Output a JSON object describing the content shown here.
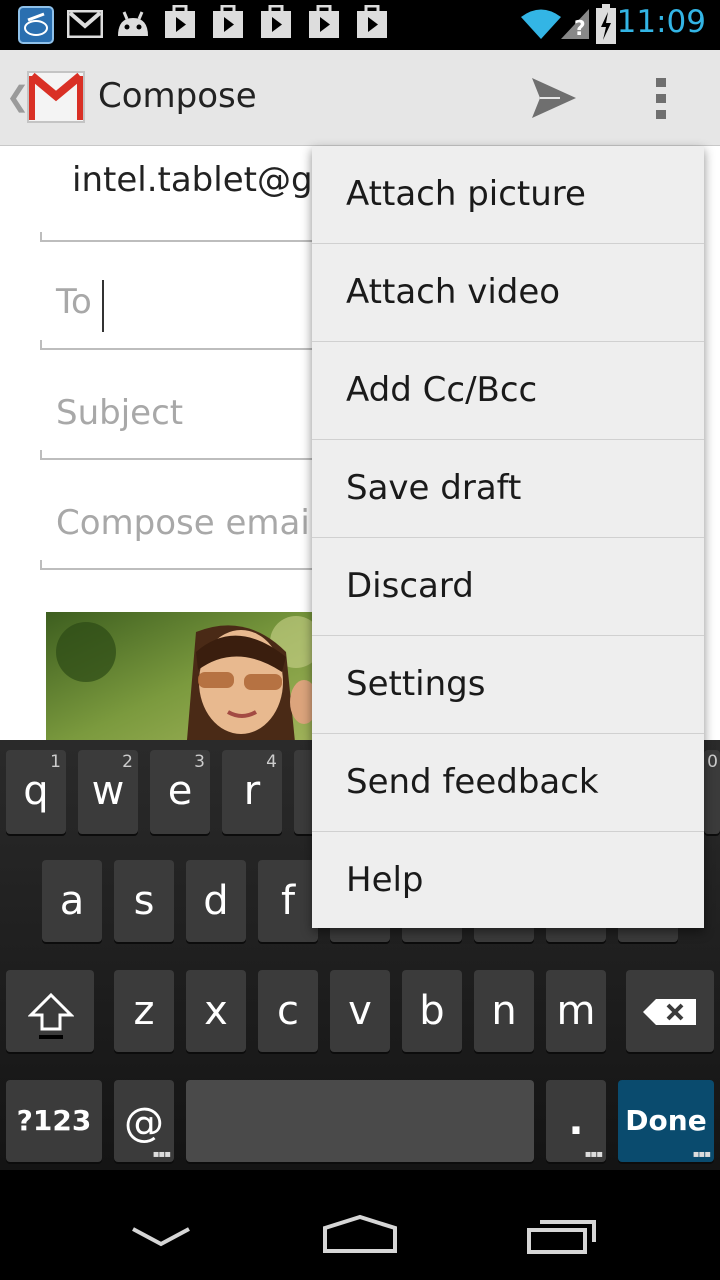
{
  "status_bar": {
    "time": "11:09",
    "icons": [
      "intel-app-icon",
      "gmail-icon",
      "android-icon",
      "play-store-icon",
      "play-store-icon",
      "play-store-icon",
      "play-store-icon",
      "play-store-icon",
      "wifi-icon",
      "no-signal-icon",
      "battery-charging-icon"
    ],
    "time_color": "#33b5e5"
  },
  "action_bar": {
    "title": "Compose",
    "app_icon": "gmail-icon",
    "send_icon": "send-icon",
    "overflow_icon": "overflow-menu-icon"
  },
  "compose": {
    "from": "intel.tablet@gmail.com",
    "to_placeholder": "To",
    "subject_placeholder": "Subject",
    "body_placeholder": "Compose email"
  },
  "menu": {
    "items": [
      "Attach picture",
      "Attach video",
      "Add Cc/Bcc",
      "Save draft",
      "Discard",
      "Settings",
      "Send feedback",
      "Help"
    ]
  },
  "keyboard": {
    "row1": [
      {
        "label": "q",
        "hint": "1"
      },
      {
        "label": "w",
        "hint": "2"
      },
      {
        "label": "e",
        "hint": "3"
      },
      {
        "label": "r",
        "hint": "4"
      }
    ],
    "row2": [
      "a",
      "s",
      "d",
      "f"
    ],
    "row3": [
      "z",
      "x",
      "c",
      "v",
      "b",
      "n",
      "m"
    ],
    "symbols_key": "?123",
    "at_key": "@",
    "period_key": ".",
    "done_key": "Done",
    "right_edge_hint": "0"
  },
  "navigation": {
    "icons": [
      "back-icon",
      "home-icon",
      "recent-apps-icon"
    ]
  }
}
